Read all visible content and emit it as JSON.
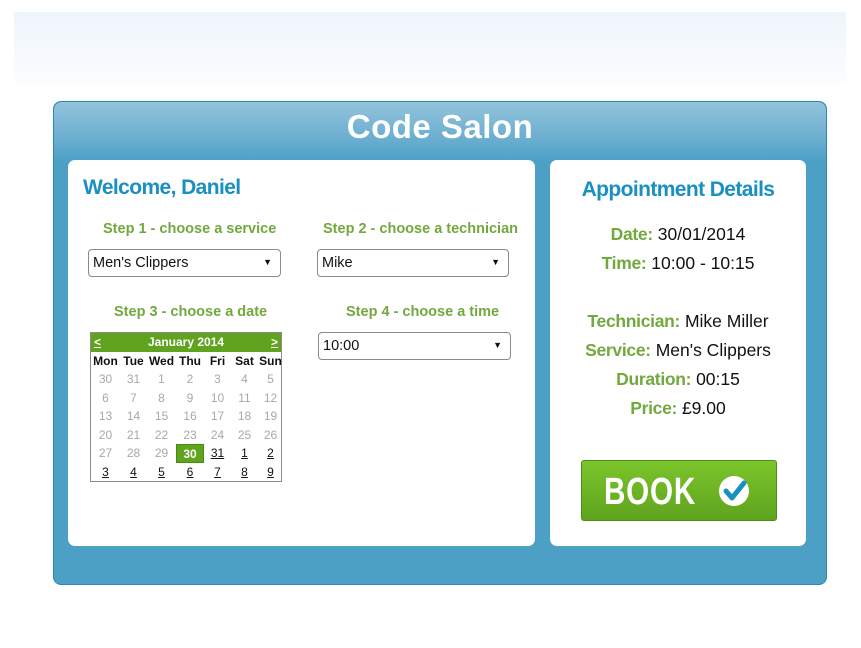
{
  "app": {
    "title": "Code Salon"
  },
  "booking": {
    "welcome": "Welcome, Daniel",
    "step1": {
      "label": "Step 1 - choose a service",
      "value": "Men's Clippers"
    },
    "step2": {
      "label": "Step 2 - choose a technician",
      "value": "Mike"
    },
    "step3": {
      "label": "Step 3 - choose a date"
    },
    "step4": {
      "label": "Step 4 - choose a time",
      "value": "10:00"
    },
    "dropdown_arrow": "▼"
  },
  "calendar": {
    "prev_label": "<",
    "next_label": ">",
    "month_label": "January 2014",
    "weekdays": [
      "Mon",
      "Tue",
      "Wed",
      "Thu",
      "Fri",
      "Sat",
      "Sun"
    ],
    "selected_day": "30",
    "colors": {
      "header": "#5fa31e",
      "selected": "#5fa31e"
    },
    "weeks": [
      [
        {
          "d": "30",
          "s": "dis"
        },
        {
          "d": "31",
          "s": "dis"
        },
        {
          "d": "1",
          "s": "dis"
        },
        {
          "d": "2",
          "s": "dis"
        },
        {
          "d": "3",
          "s": "dis"
        },
        {
          "d": "4",
          "s": "dis"
        },
        {
          "d": "5",
          "s": "dis"
        }
      ],
      [
        {
          "d": "6",
          "s": "dis"
        },
        {
          "d": "7",
          "s": "dis"
        },
        {
          "d": "8",
          "s": "dis"
        },
        {
          "d": "9",
          "s": "dis"
        },
        {
          "d": "10",
          "s": "dis"
        },
        {
          "d": "11",
          "s": "dis"
        },
        {
          "d": "12",
          "s": "dis"
        }
      ],
      [
        {
          "d": "13",
          "s": "dis"
        },
        {
          "d": "14",
          "s": "dis"
        },
        {
          "d": "15",
          "s": "dis"
        },
        {
          "d": "16",
          "s": "dis"
        },
        {
          "d": "17",
          "s": "dis"
        },
        {
          "d": "18",
          "s": "dis"
        },
        {
          "d": "19",
          "s": "dis"
        }
      ],
      [
        {
          "d": "20",
          "s": "dis"
        },
        {
          "d": "21",
          "s": "dis"
        },
        {
          "d": "22",
          "s": "dis"
        },
        {
          "d": "23",
          "s": "dis"
        },
        {
          "d": "24",
          "s": "dis"
        },
        {
          "d": "25",
          "s": "dis"
        },
        {
          "d": "26",
          "s": "dis"
        }
      ],
      [
        {
          "d": "27",
          "s": "dis"
        },
        {
          "d": "28",
          "s": "dis"
        },
        {
          "d": "29",
          "s": "dis"
        },
        {
          "d": "30",
          "s": "sel"
        },
        {
          "d": "31",
          "s": "avail"
        },
        {
          "d": "1",
          "s": "avail"
        },
        {
          "d": "2",
          "s": "avail"
        }
      ],
      [
        {
          "d": "3",
          "s": "avail"
        },
        {
          "d": "4",
          "s": "avail"
        },
        {
          "d": "5",
          "s": "avail"
        },
        {
          "d": "6",
          "s": "avail"
        },
        {
          "d": "7",
          "s": "avail"
        },
        {
          "d": "8",
          "s": "avail"
        },
        {
          "d": "9",
          "s": "avail"
        }
      ]
    ]
  },
  "details": {
    "title": "Appointment Details",
    "date": {
      "label": "Date:",
      "value": "30/01/2014"
    },
    "time": {
      "label": "Time:",
      "value": "10:00 - 10:15"
    },
    "technician": {
      "label": "Technician:",
      "value": "Mike Miller"
    },
    "service": {
      "label": "Service:",
      "value": "Men's Clippers"
    },
    "duration": {
      "label": "Duration:",
      "value": "00:15"
    },
    "price": {
      "label": "Price:",
      "value": "£9.00"
    }
  },
  "book_button": {
    "label": "BOOK",
    "icon": "check-circle-icon"
  },
  "colors": {
    "brand_blue": "#4ca0c6",
    "heading_blue": "#1a8fc1",
    "label_green": "#72a83e",
    "button_green": "#6cb424"
  }
}
